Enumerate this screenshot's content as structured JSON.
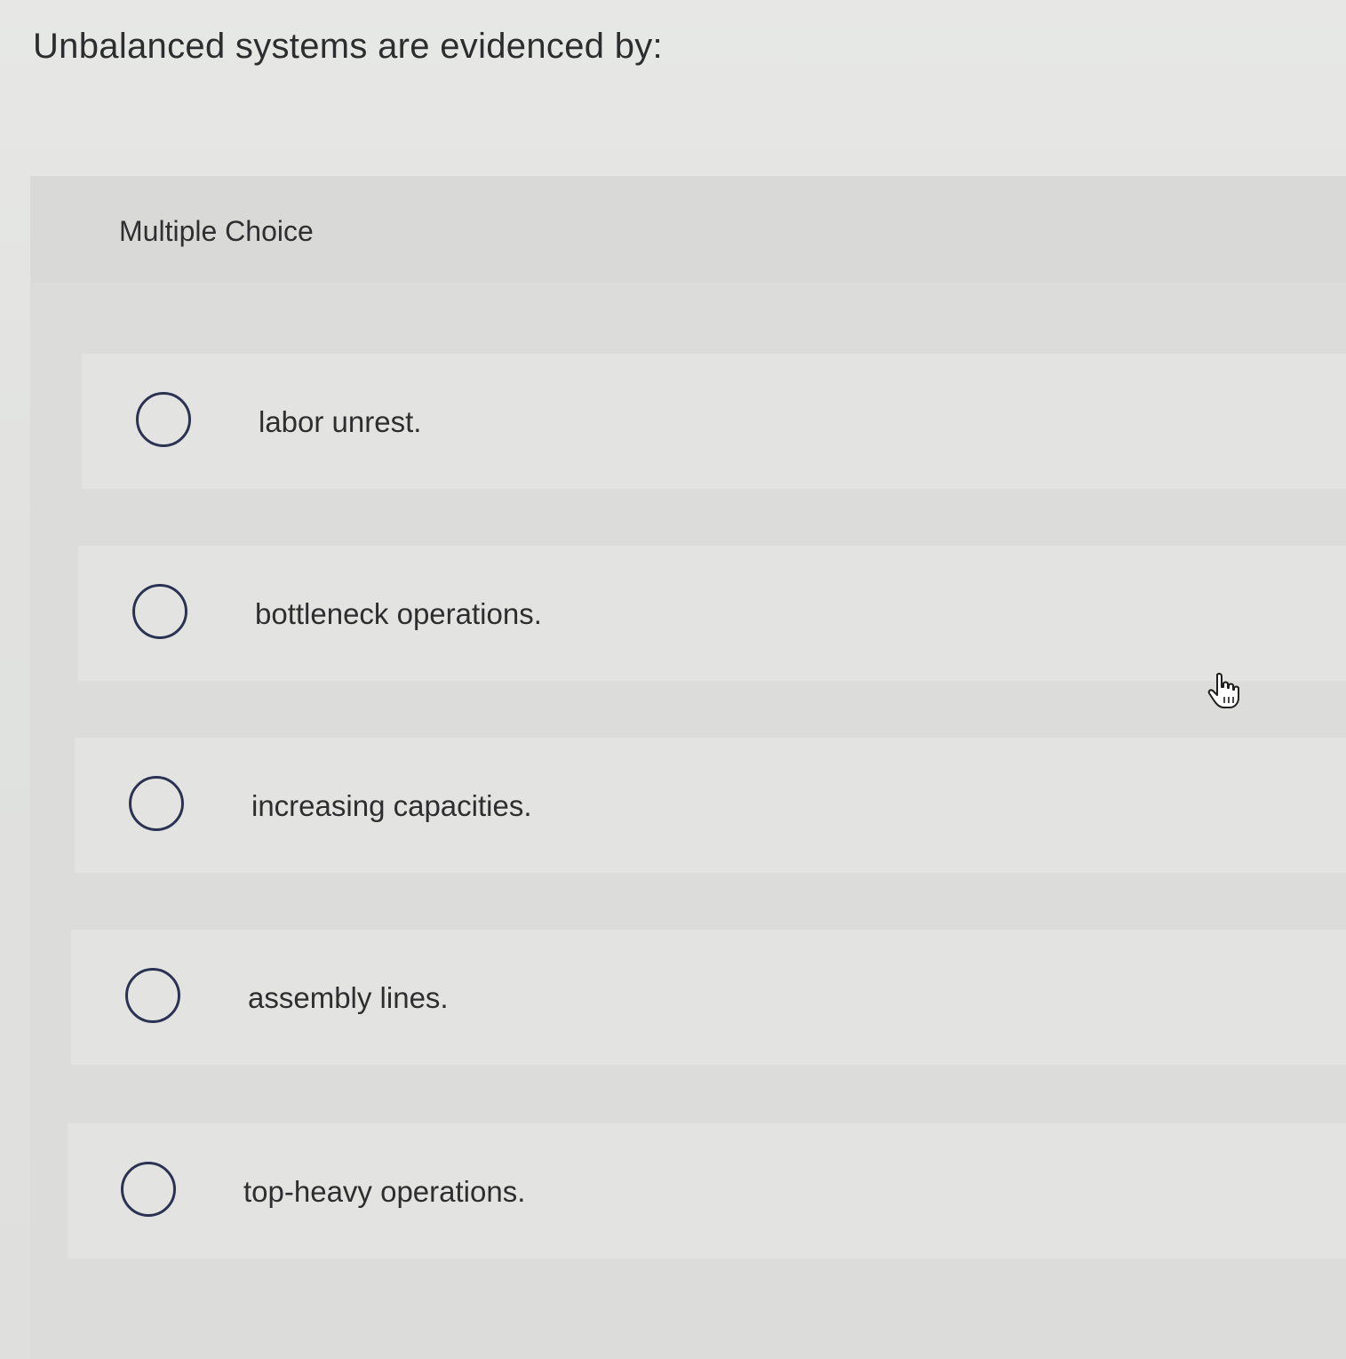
{
  "question": {
    "text": "Unbalanced systems are evidenced by:"
  },
  "section": {
    "type_label": "Multiple Choice"
  },
  "options": [
    {
      "label": "labor unrest.",
      "selected": false
    },
    {
      "label": "bottleneck operations.",
      "selected": false
    },
    {
      "label": "increasing capacities.",
      "selected": false
    },
    {
      "label": "assembly lines.",
      "selected": false
    },
    {
      "label": "top-heavy operations.",
      "selected": false
    }
  ],
  "icons": {
    "radio": "radio-unchecked-icon",
    "cursor": "hand-pointer-icon"
  },
  "colors": {
    "radio_border": "#2c3352",
    "text": "#2e2e30"
  }
}
